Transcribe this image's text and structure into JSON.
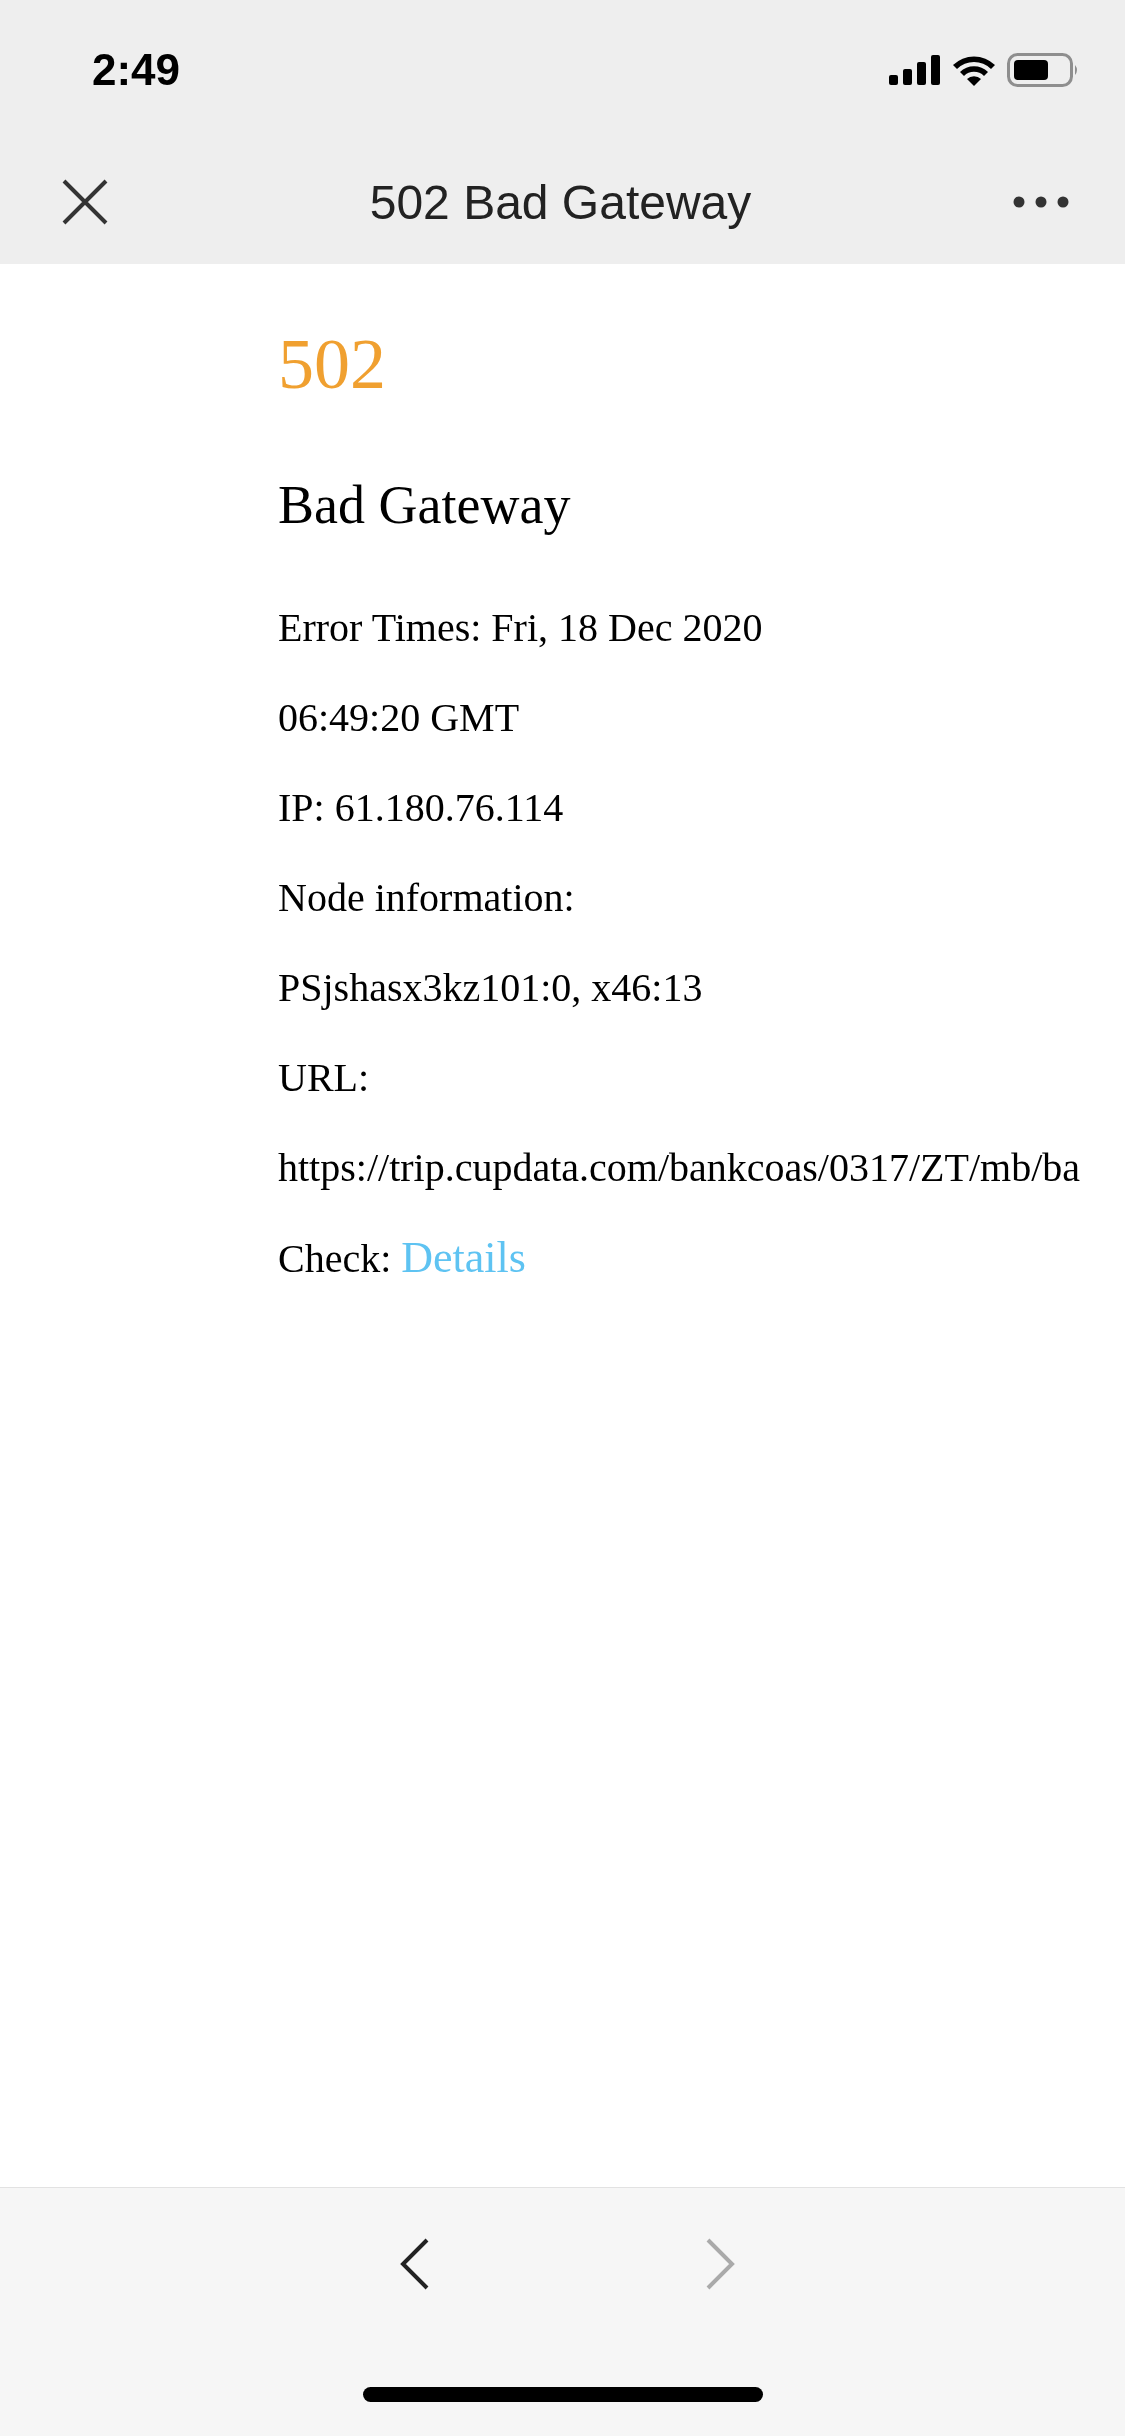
{
  "status_bar": {
    "time": "2:49"
  },
  "nav_bar": {
    "title": "502 Bad Gateway"
  },
  "page": {
    "code": "502",
    "heading": "Bad Gateway",
    "lines": [
      {
        "kind": "text",
        "text": "Error Times: Fri, 18 Dec 2020"
      },
      {
        "kind": "text",
        "text": "06:49:20 GMT"
      },
      {
        "kind": "text",
        "text": "IP: 61.180.76.114"
      },
      {
        "kind": "text",
        "text": "Node information:"
      },
      {
        "kind": "text",
        "text": "PSjshasx3kz101:0, x46:13"
      },
      {
        "kind": "text",
        "text": "URL:"
      },
      {
        "kind": "text",
        "text": "https://trip.cupdata.com/bankcoas/0317/ZT/mb/ba"
      },
      {
        "kind": "link",
        "text": "Check:",
        "link": "Details"
      }
    ]
  },
  "toolbar": {
    "back": {
      "disabled": false
    },
    "forward": {
      "disabled": true
    }
  }
}
